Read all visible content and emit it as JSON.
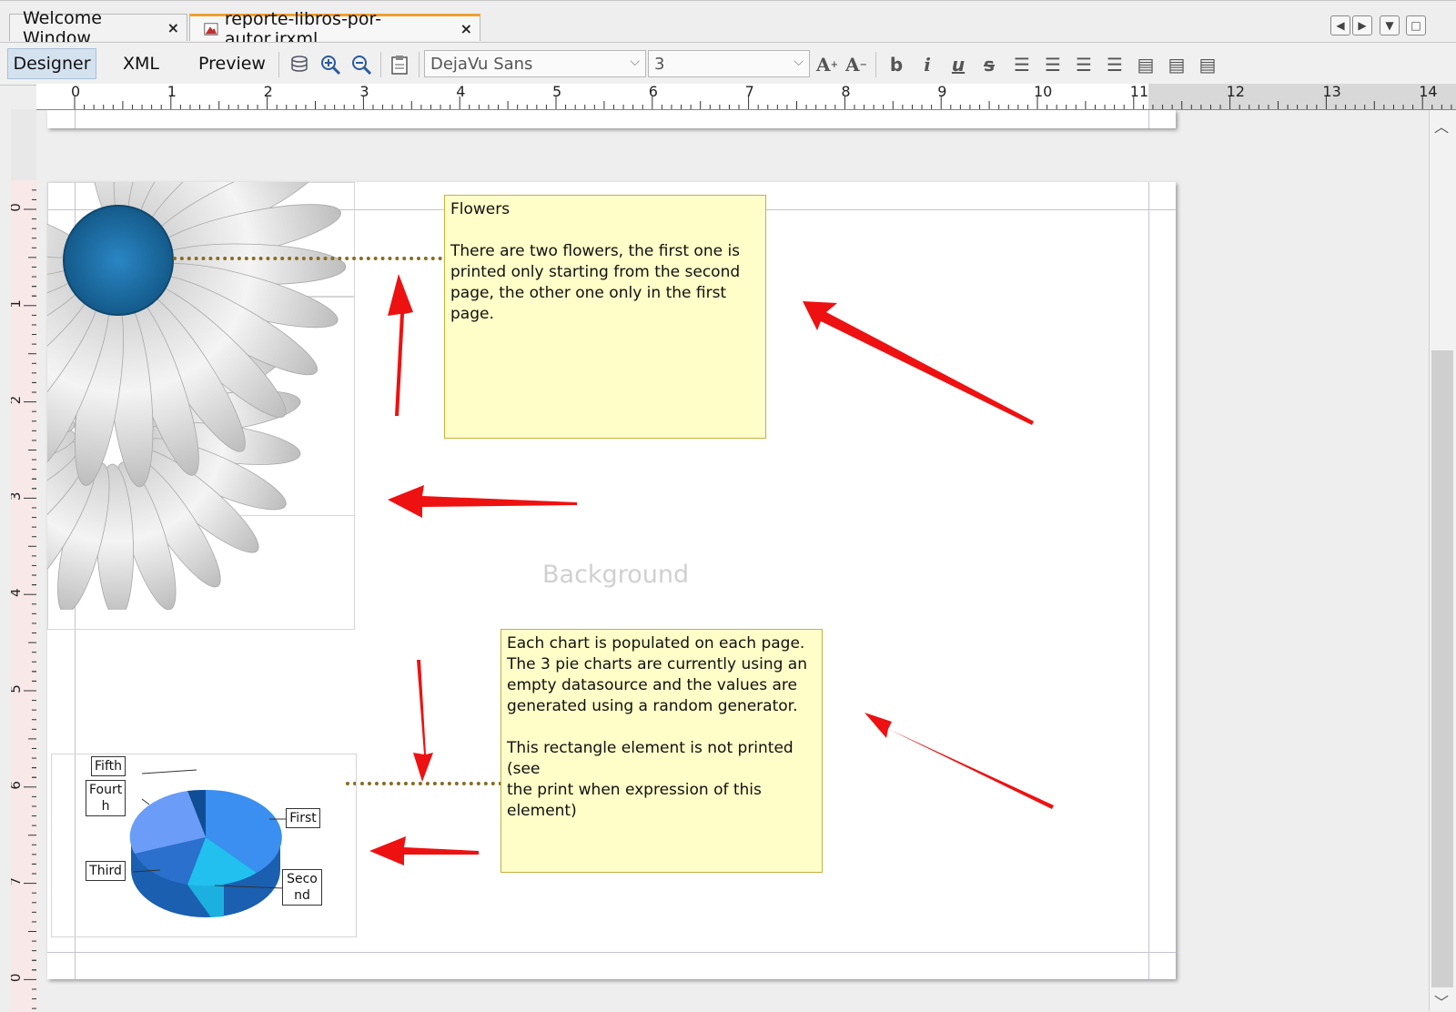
{
  "tabs": [
    {
      "label": "Welcome Window",
      "active": false
    },
    {
      "label": "reporte-libros-por-autor.jrxml",
      "active": true
    }
  ],
  "toolbar": {
    "views": [
      "Designer",
      "XML",
      "Preview"
    ],
    "selected_view": "Designer",
    "font_name": "DejaVu Sans",
    "font_size": "3",
    "icons": [
      "datasource-icon",
      "zoom-in-icon",
      "zoom-out-icon",
      "clipboard-icon",
      "increase-font-icon",
      "decrease-font-icon",
      "bold-icon",
      "italic-icon",
      "underline-icon",
      "strikethrough-icon",
      "align-left-icon",
      "align-justify-icon",
      "align-center-icon",
      "align-right-icon",
      "align-top-icon",
      "align-middle-icon",
      "align-bottom-icon"
    ]
  },
  "ruler": {
    "horizontal": [
      "0",
      "1",
      "2",
      "3",
      "4",
      "5",
      "6",
      "7",
      "8",
      "9",
      "10",
      "11",
      "12",
      "13",
      "14"
    ],
    "vertical": [
      "0",
      "1",
      "2",
      "3",
      "4",
      "5",
      "6",
      "7",
      "0"
    ]
  },
  "notes": {
    "flowers": {
      "title": "Flowers",
      "body_lines": [
        "There are two flowers, the first one is",
        "printed only starting from the second",
        "page, the other one only in the first page."
      ]
    },
    "charts": {
      "lines1": [
        "Each chart is populated on each page.",
        "The 3 pie charts are currently using an",
        "empty datasource and the values are",
        "generated using a random generator."
      ],
      "lines2": [
        "This rectangle element is not printed (see",
        "the print when expression of this",
        "element)"
      ]
    }
  },
  "band": {
    "label": "Background"
  },
  "pie": {
    "labels": [
      {
        "key": "fifth",
        "text": "Fifth"
      },
      {
        "key": "fourth",
        "text": "Fourt\nh"
      },
      {
        "key": "third",
        "text": "Third"
      },
      {
        "key": "first",
        "text": "First"
      },
      {
        "key": "second",
        "text": "Seco\nnd"
      }
    ]
  },
  "colors": {
    "note_bg": "#fffdc8",
    "arrow": "#ee1111",
    "flower_center": "#1a6fa8",
    "tab_accent": "#f0a030"
  }
}
